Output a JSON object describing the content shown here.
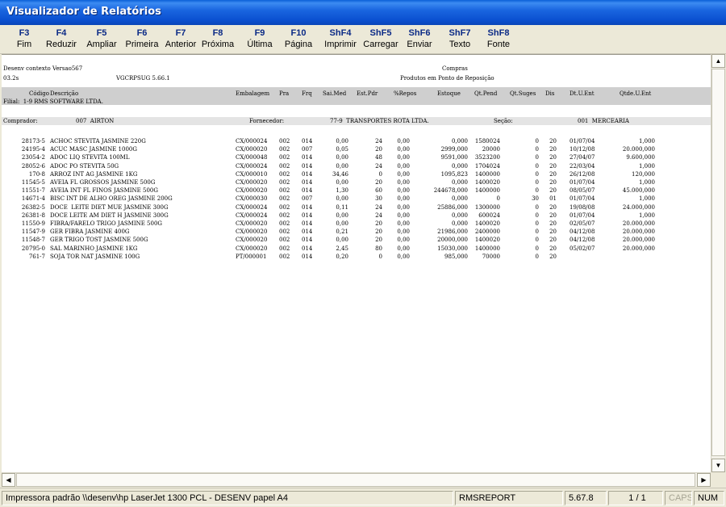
{
  "window": {
    "title": "Visualizador de Relatórios"
  },
  "toolbar": [
    {
      "key": "F3",
      "label": "Fim"
    },
    {
      "key": "F4",
      "label": "Reduzir"
    },
    {
      "key": "F5",
      "label": "Ampliar"
    },
    {
      "key": "F6",
      "label": "Primeira"
    },
    {
      "key": "F7",
      "label": "Anterior"
    },
    {
      "key": "F8",
      "label": "Próxima"
    },
    {
      "key": "F9",
      "label": "Última"
    },
    {
      "key": "F10",
      "label": "Página"
    },
    {
      "key": "ShF4",
      "label": "Imprimir"
    },
    {
      "key": "ShF5",
      "label": "Carregar"
    },
    {
      "key": "ShF6",
      "label": "Enviar"
    },
    {
      "key": "ShF7",
      "label": "Texto"
    },
    {
      "key": "ShF8",
      "label": "Fonte"
    }
  ],
  "report": {
    "context": "Desenv contexto Versao567",
    "version": "03.2s",
    "program": "VGCRPSUG 5.66.1",
    "module": "Compras",
    "title": "Produtos em Ponto de Reposição",
    "filial": "Filial:  1-9 RMS SOFTWARE LTDA.",
    "columns": [
      "Código",
      "Descrição",
      "Embalagem",
      "Pra",
      "Frq",
      "Sai.Med",
      "Est.Pdr",
      "%Repos",
      "Estoque",
      "Qt.Pend",
      "Qt.Suges",
      "Dis",
      "Dt.U.Ent",
      "Qtde.U.Ent"
    ],
    "buyer_label": "Comprador:",
    "buyer_value": "007  AIRTON",
    "supplier_label": "Fornecedor:",
    "supplier_value": "77-9  TRANSPORTES ROTA LTDA.",
    "section_label": "Seção:",
    "section_value": "001  MERCEARIA",
    "rows": [
      [
        "28173-5",
        "ACHOC STEVITA JASMINE 220G",
        "CX/000024",
        "002",
        "014",
        "0,00",
        "24",
        "0,00",
        "0,000",
        "1580024",
        "0",
        "20",
        "01/07/04",
        "1,000"
      ],
      [
        "24195-4",
        "ACUC MASC JASMINE 1000G",
        "CX/000020",
        "002",
        "007",
        "0,05",
        "20",
        "0,00",
        "2999,000",
        "20000",
        "0",
        "20",
        "10/12/08",
        "20.000,000"
      ],
      [
        "23054-2",
        "ADOC LIQ STEVITA 100ML",
        "CX/000048",
        "002",
        "014",
        "0,00",
        "48",
        "0,00",
        "9591,000",
        "3523200",
        "0",
        "20",
        "27/04/07",
        "9.600,000"
      ],
      [
        "28052-6",
        "ADOC PO STEVITA 50G",
        "CX/000024",
        "002",
        "014",
        "0,00",
        "24",
        "0,00",
        "0,000",
        "1704024",
        "0",
        "20",
        "22/03/04",
        "1,000"
      ],
      [
        "170-8",
        "ARROZ INT AG JASMINE 1KG",
        "CX/000010",
        "002",
        "014",
        "34,46",
        "0",
        "0,00",
        "1095,823",
        "1400000",
        "0",
        "20",
        "26/12/08",
        "120,000"
      ],
      [
        "11545-5",
        "AVEIA FL GROSSOS JASMINE 500G",
        "CX/000020",
        "002",
        "014",
        "0,00",
        "20",
        "0,00",
        "0,000",
        "1400020",
        "0",
        "20",
        "01/07/04",
        "1,000"
      ],
      [
        "11551-7",
        "AVEIA INT FL FINOS JASMINE 500G",
        "CX/000020",
        "002",
        "014",
        "1,30",
        "60",
        "0,00",
        "244678,000",
        "1400000",
        "0",
        "20",
        "08/05/07",
        "45.000,000"
      ],
      [
        "14671-4",
        "BISC INT DE ALHO OREG JASMINE 200G",
        "CX/000030",
        "002",
        "007",
        "0,00",
        "30",
        "0,00",
        "0,000",
        "0",
        "30",
        "01",
        "01/07/04",
        "1,000"
      ],
      [
        "26382-5",
        "DOCE  LEITE DIET MUE JASMINE 300G",
        "CX/000024",
        "002",
        "014",
        "0,11",
        "24",
        "0,00",
        "25886,000",
        "1300000",
        "0",
        "20",
        "19/08/08",
        "24.000,000"
      ],
      [
        "26381-8",
        "DOCE LEITE AM DIET H JASMINE 300G",
        "CX/000024",
        "002",
        "014",
        "0,00",
        "24",
        "0,00",
        "0,000",
        "600024",
        "0",
        "20",
        "01/07/04",
        "1,000"
      ],
      [
        "11550-9",
        "FIBRA/FARELO TRIGO JASMINE 500G",
        "CX/000020",
        "002",
        "014",
        "0,00",
        "20",
        "0,00",
        "0,000",
        "1400020",
        "0",
        "20",
        "02/05/07",
        "20.000,000"
      ],
      [
        "11547-9",
        "GER FIBRA JASMINE 400G",
        "CX/000020",
        "002",
        "014",
        "0,21",
        "20",
        "0,00",
        "21986,000",
        "2400000",
        "0",
        "20",
        "04/12/08",
        "20.000,000"
      ],
      [
        "11548-7",
        "GER TRIGO TOST JASMINE 500G",
        "CX/000020",
        "002",
        "014",
        "0,00",
        "20",
        "0,00",
        "20000,000",
        "1400020",
        "0",
        "20",
        "04/12/08",
        "20.000,000"
      ],
      [
        "20795-0",
        "SAL MARINHO JASMINE 1KG",
        "CX/000020",
        "002",
        "014",
        "2,45",
        "80",
        "0,00",
        "15030,000",
        "1400000",
        "0",
        "20",
        "05/02/07",
        "20.000,000"
      ],
      [
        "761-7",
        "SOJA TOR NAT JASMINE 100G",
        "PT/000001",
        "002",
        "014",
        "0,20",
        "0",
        "0,00",
        "985,000",
        "70000",
        "0",
        "20",
        "",
        ""
      ]
    ]
  },
  "scrollbars": {
    "up_icon": "arrow-up-icon",
    "down_icon": "arrow-down-icon",
    "left_icon": "arrow-left-icon",
    "right_icon": "arrow-right-icon"
  },
  "status": {
    "printer": "Impressora padrão \\\\desenv\\hp LaserJet 1300 PCL - DESENV papel A4",
    "report": "RMSREPORT",
    "version": "5.67.8",
    "pages": "1 / 1",
    "caps": "CAPS",
    "num": "NUM"
  }
}
